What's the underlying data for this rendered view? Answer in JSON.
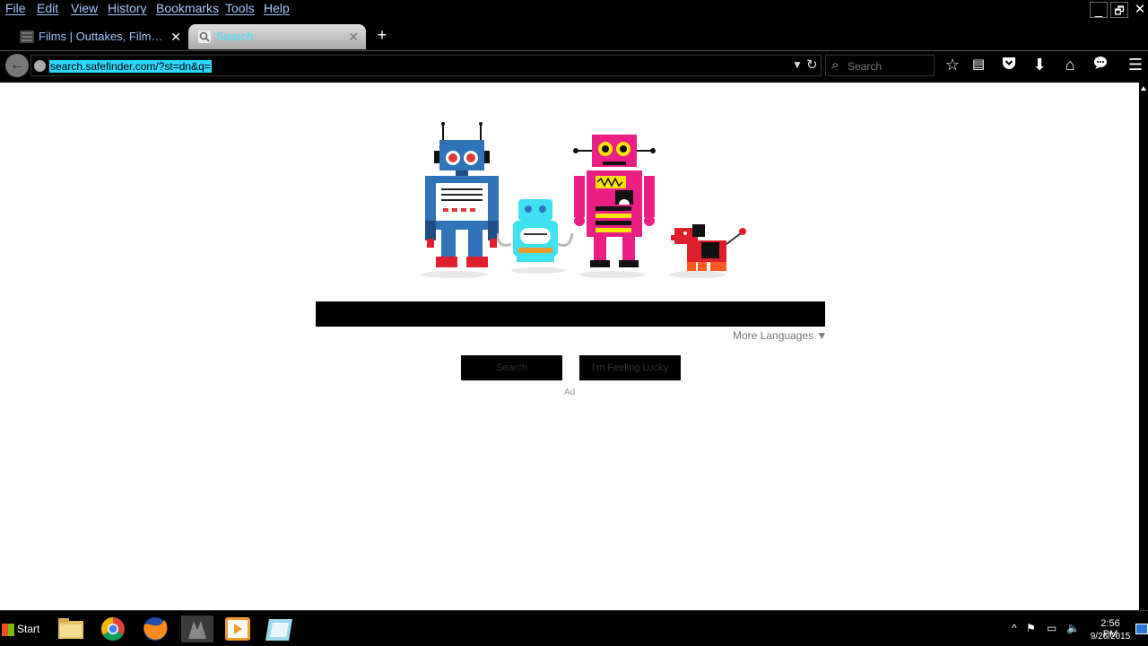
{
  "menubar": {
    "items": [
      "File",
      "Edit",
      "View",
      "History",
      "Bookmarks",
      "Tools",
      "Help"
    ]
  },
  "window": {
    "minimize": "_",
    "restore": "🗗",
    "close": "✕"
  },
  "tabs": [
    {
      "label": "Films | Outtakes, Film Co...",
      "close": "✕",
      "icon": "film-icon"
    },
    {
      "label": "Search",
      "close": "✕",
      "icon": "search-icon"
    }
  ],
  "new_tab": "+",
  "toolbar": {
    "url": "search.safefinder.com/?st=dn&q=",
    "search_placeholder": "Search",
    "icons": [
      "star-icon",
      "reading-list-icon",
      "pocket-icon",
      "download-icon",
      "home-icon",
      "chat-icon",
      "menu-icon"
    ]
  },
  "page": {
    "more_languages": "More Languages ▼",
    "search_button": "Search",
    "lucky_button": "I'm Feeling Lucky",
    "ad_label": "Ad"
  },
  "taskbar": {
    "start": "Start",
    "time": "2:56 PM",
    "date": "9/26/2015",
    "apps": [
      "folder-icon",
      "chrome-icon",
      "firefox-icon",
      "game-icon",
      "media-player-icon",
      "notes-icon"
    ]
  },
  "colors": {
    "accent_cyan": "#2bd9ff",
    "menu_blue": "#a7c7ff",
    "robot_blue": "#2f73b9",
    "robot_cyan": "#3fe0f2",
    "robot_pink": "#ea1f86",
    "robot_red": "#e01f2c"
  }
}
